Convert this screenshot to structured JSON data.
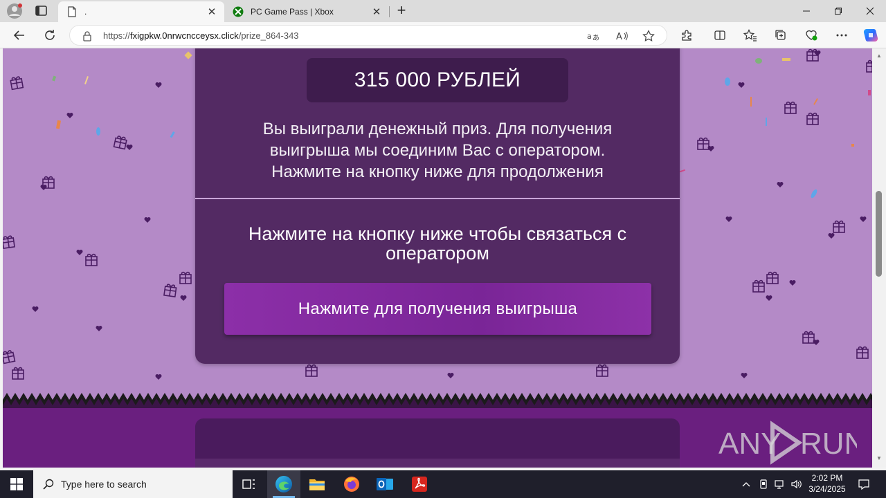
{
  "browser": {
    "tabs": [
      {
        "title": ".",
        "close": "✕",
        "active": true
      },
      {
        "title": "PC Game Pass | Xbox",
        "close": "✕",
        "active": false
      }
    ],
    "new_tab": "+",
    "url_prefix": "https://",
    "url_host": "fxigpkw.0nrwcncceysx.click",
    "url_path": "/prize_864-343",
    "window_controls": {
      "minimize": "—",
      "maximize": "❐",
      "close": "✕"
    },
    "icons": [
      "profile-icon",
      "tab-actions-icon",
      "back-icon",
      "refresh-icon",
      "lock-icon",
      "translate-icon",
      "read-aloud-icon",
      "favorite-star-icon",
      "extensions-icon",
      "split-screen-icon",
      "favorites-icon",
      "collections-icon",
      "browser-essentials-icon",
      "more-icon",
      "copilot-icon"
    ]
  },
  "page": {
    "amount": "315 000 РУБЛЕЙ",
    "message_lines": [
      "Вы выиграли денежный приз. Для получения",
      "выигрыша мы соединим Вас с оператором.",
      "Нажмите на кнопку ниже для продолжения"
    ],
    "cta_lines": [
      "Нажмите на кнопку ниже чтобы связаться с",
      "оператором"
    ],
    "button_label": "Нажмите для получения выигрыша",
    "colors": {
      "background": "#b48ac7",
      "card": "#532a63",
      "amount_box": "#3e1c4d",
      "button": "#8c2fa8",
      "lower_band": "#6a1f7f"
    }
  },
  "watermark": {
    "text_left": "ANY",
    "text_right": "RUN"
  },
  "taskbar": {
    "search_placeholder": "Type here to search",
    "apps": [
      "task-view-icon",
      "edge-icon",
      "file-explorer-icon",
      "firefox-icon",
      "outlook-icon",
      "acrobat-icon"
    ],
    "time": "2:02 PM",
    "date": "3/24/2025"
  }
}
